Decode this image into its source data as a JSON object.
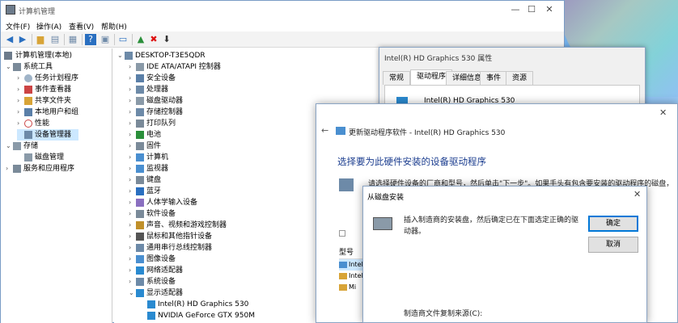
{
  "main_window": {
    "title": "计算机管理",
    "buttons": {
      "minimize": "—",
      "maximize": "☐",
      "close": "✕"
    },
    "menu": [
      "文件(F)",
      "操作(A)",
      "查看(V)",
      "帮助(H)"
    ]
  },
  "left_tree": {
    "root": "计算机管理(本地)",
    "system_tools": "系统工具",
    "items": [
      "任务计划程序",
      "事件查看器",
      "共享文件夹",
      "本地用户和组",
      "性能",
      "设备管理器"
    ],
    "storage": "存储",
    "disk_mgmt": "磁盘管理",
    "services": "服务和应用程序"
  },
  "device_tree": {
    "root": "DESKTOP-T3E5QDR",
    "categories": [
      "IDE ATA/ATAPI 控制器",
      "安全设备",
      "处理器",
      "磁盘驱动器",
      "存储控制器",
      "打印队列",
      "电池",
      "固件",
      "计算机",
      "监视器",
      "键盘",
      "蓝牙",
      "人体学输入设备",
      "软件设备",
      "声音、视频和游戏控制器",
      "鼠标和其他指针设备",
      "通用串行总线控制器",
      "图像设备",
      "网络适配器",
      "系统设备",
      "显示适配器"
    ],
    "display_adapters": [
      "Intel(R) HD Graphics 530",
      "NVIDIA GeForce GTX 950M"
    ]
  },
  "properties": {
    "title": "Intel(R) HD Graphics 530 属性",
    "tabs": [
      "常规",
      "驱动程序",
      "详细信息",
      "事件",
      "资源"
    ],
    "device_name": "Intel(R) HD Graphics 530"
  },
  "wizard": {
    "title": "更新驱动程序软件 - Intel(R) HD Graphics 530",
    "heading": "选择要为此硬件安装的设备驱动程序",
    "description": "请选择硬件设备的厂商和型号，然后单击\"下一步\"。如果手头有包含要安装的驱动程序的磁盘，",
    "list_header": "型号",
    "list_items": [
      "Intel",
      "Intel",
      "Mi"
    ],
    "back_arrow": "←"
  },
  "disk_dialog": {
    "title": "从磁盘安装",
    "message": "插入制造商的安装盘，然后确定已在下面选定正确的驱动器。",
    "ok": "确定",
    "cancel": "取消",
    "manufacturer_label": "制造商文件复制来源(C):",
    "close": "✕"
  }
}
